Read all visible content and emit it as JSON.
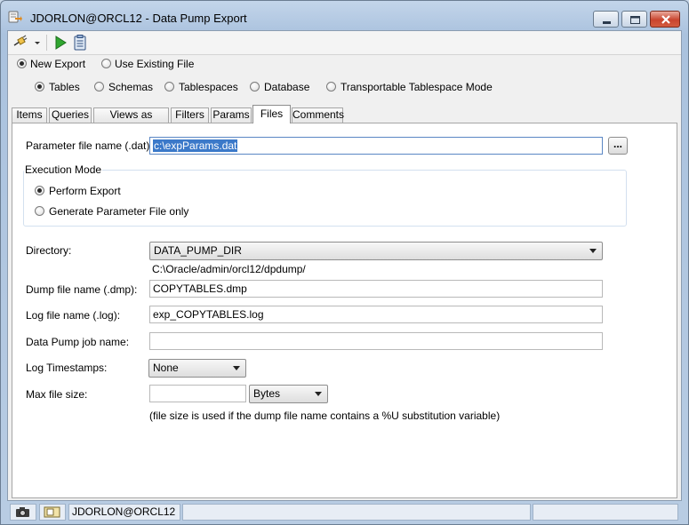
{
  "window": {
    "title": "JDORLON@ORCL12 - Data Pump Export"
  },
  "icons": {
    "app": "database-export-icon",
    "minimize": "minimize-icon",
    "maximize": "maximize-icon",
    "close": "close-icon",
    "connection": "connection-plug-icon",
    "dropdown": "chevron-down-icon",
    "run": "play-icon",
    "script": "clipboard-icon",
    "camera": "camera-icon",
    "status_doc": "document-icon"
  },
  "export_source": {
    "new_export": "New Export",
    "use_existing": "Use Existing File",
    "selected": "new_export"
  },
  "export_mode": {
    "tables": "Tables",
    "schemas": "Schemas",
    "tablespaces": "Tablespaces",
    "database": "Database",
    "transportable": "Transportable Tablespace Mode",
    "selected": "tables"
  },
  "tabs": [
    {
      "label": "Items"
    },
    {
      "label": "Queries"
    },
    {
      "label": "Views as Tables"
    },
    {
      "label": "Filters"
    },
    {
      "label": "Params"
    },
    {
      "label": "Files",
      "active": true
    },
    {
      "label": "Comments"
    }
  ],
  "files": {
    "param_file_label": "Parameter file name (.dat):",
    "param_file_value": "c:\\expParams.dat",
    "browse_label": "...",
    "execution_mode": {
      "legend": "Execution Mode",
      "perform_export": "Perform Export",
      "generate_only": "Generate Parameter File only",
      "selected": "perform_export"
    },
    "directory_label": "Directory:",
    "directory_value": "DATA_PUMP_DIR",
    "directory_path": "C:\\Oracle/admin/orcl12/dpdump/",
    "dump_file_label": "Dump file name (.dmp):",
    "dump_file_value": "COPYTABLES.dmp",
    "log_file_label": "Log file name (.log):",
    "log_file_value": "exp_COPYTABLES.log",
    "job_name_label": "Data Pump job name:",
    "job_name_value": "",
    "log_timestamps_label": "Log Timestamps:",
    "log_timestamps_value": "None",
    "max_size_label": "Max file size:",
    "max_size_value": "",
    "max_size_unit": "Bytes",
    "note": "(file size is used if the dump file name contains a %U substitution variable)"
  },
  "statusbar": {
    "connection": "JDORLON@ORCL12"
  },
  "colors": {
    "frame": "#aac2de",
    "selection": "#3b79c9",
    "run_green": "#2fa62f",
    "close_red": "#c9452f"
  }
}
